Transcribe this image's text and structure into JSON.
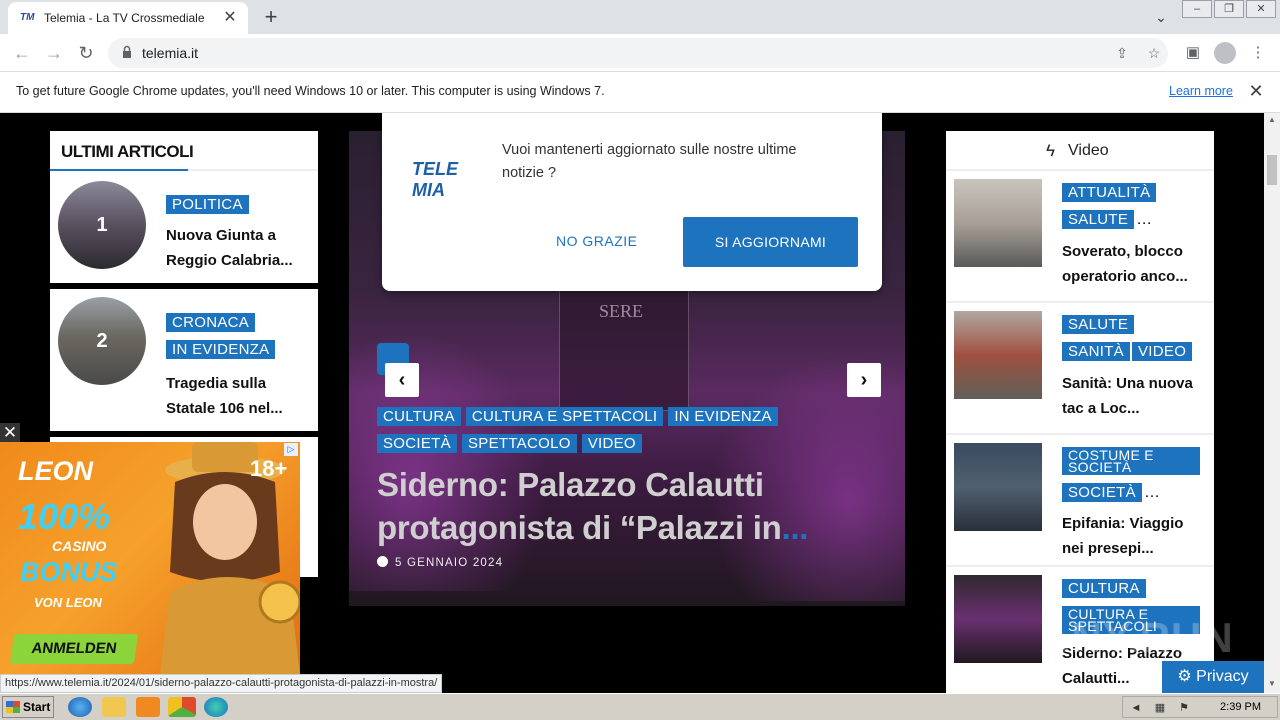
{
  "browser": {
    "tab_title": "Telemia - La TV Crossmediale",
    "tab_close": "✕",
    "new_tab": "+",
    "url": "telemia.it"
  },
  "infobar": {
    "message": "To get future Google Chrome updates, you'll need Windows 10 or later. This computer is using Windows 7.",
    "link": "Learn more",
    "close": "✕"
  },
  "left_widget": {
    "title": "ULTIMI ARTICOLI",
    "articles": [
      {
        "num": "1",
        "tags": [
          "POLITICA"
        ],
        "title": "Nuova Giunta a Reggio Calabria..."
      },
      {
        "num": "2",
        "tags": [
          "CRONACA",
          "IN EVIDENZA"
        ],
        "title": "Tragedia sulla Statale 106 nel..."
      }
    ]
  },
  "popup": {
    "logo": "TELE MIA",
    "message": "Vuoi mantenerti aggiornato sulle nostre ultime notizie ?",
    "decline": "NO GRAZIE",
    "accept": "SI AGGIORNAMI"
  },
  "slider": {
    "tags": [
      "CULTURA",
      "CULTURA E SPETTACOLI",
      "IN EVIDENZA",
      "SOCIETÀ",
      "SPETTACOLO",
      "VIDEO"
    ],
    "title": "Siderno: Palazzo Calautti protagonista di “Palazzi in",
    "ellipsis": "...",
    "date": "5 GENNAIO 2024",
    "building_text": "SERE",
    "prev": "‹",
    "next": "›"
  },
  "video_widget": {
    "title": "Video",
    "items": [
      {
        "tags": [
          "ATTUALITÀ",
          "SALUTE"
        ],
        "more": "…",
        "title": "Soverato, blocco operatorio anco..."
      },
      {
        "tags": [
          "SALUTE",
          "SANITÀ",
          "VIDEO"
        ],
        "more": "",
        "title": "Sanità: Una nuova tac a Loc..."
      },
      {
        "tags": [
          "COSTUME E SOCIETÀ",
          "SOCIETÀ"
        ],
        "more": "…",
        "title": "Epifania: Viaggio nei presepi..."
      },
      {
        "tags": [
          "CULTURA",
          "CULTURA E SPETTACOLI"
        ],
        "more": "",
        "title": "Siderno: Palazzo Calautti..."
      }
    ]
  },
  "ad": {
    "brand": "LEON",
    "percent": "100%",
    "casino": "CASINO",
    "bonus": "BONUS",
    "von": "VON LEON",
    "cta": "ANMELDEN",
    "age": "18+",
    "close": "✕"
  },
  "status_url": "https://www.telemia.it/2024/01/siderno-palazzo-calautti-protagonista-di-palazzi-in-mostra/",
  "privacy": "Privacy",
  "watermark": "ANY.RUN",
  "taskbar": {
    "start": "Start",
    "time": "2:39 PM"
  },
  "colors": {
    "accent": "#1e73be",
    "chrome_bg": "#dee1e6"
  }
}
